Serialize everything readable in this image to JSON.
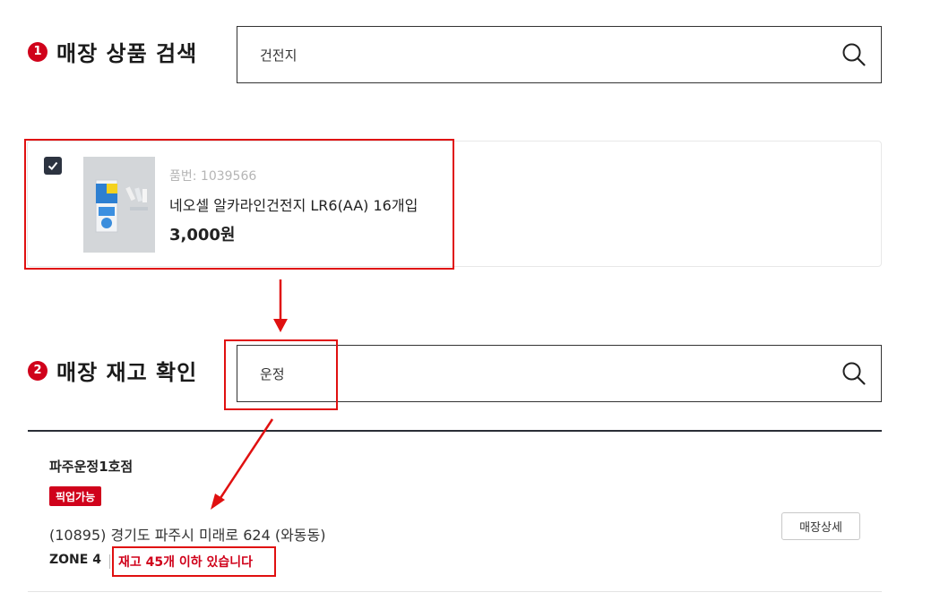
{
  "step1": {
    "number": "1",
    "title": "매장 상품 검색",
    "search_value": "건전지"
  },
  "product": {
    "code": "품번: 1039566",
    "name": "네오셀 알카라인건전지 LR6(AA) 16개입",
    "price": "3,000원",
    "checked": true
  },
  "step2": {
    "number": "2",
    "title": "매장 재고 확인",
    "search_value": "운정"
  },
  "store": {
    "name": "파주운정1호점",
    "badge": "픽업가능",
    "address": "(10895) 경기도 파주시 미래로 624 (와동동)",
    "zone": "ZONE 4",
    "stock": "재고 45개 이하 있습니다",
    "detail_button": "매장상세"
  },
  "colors": {
    "accent_red": "#d0021b",
    "annotation_red": "#e01010",
    "checkbox": "#2c3340"
  },
  "icons": {
    "search": "search-icon",
    "check": "check-icon"
  }
}
